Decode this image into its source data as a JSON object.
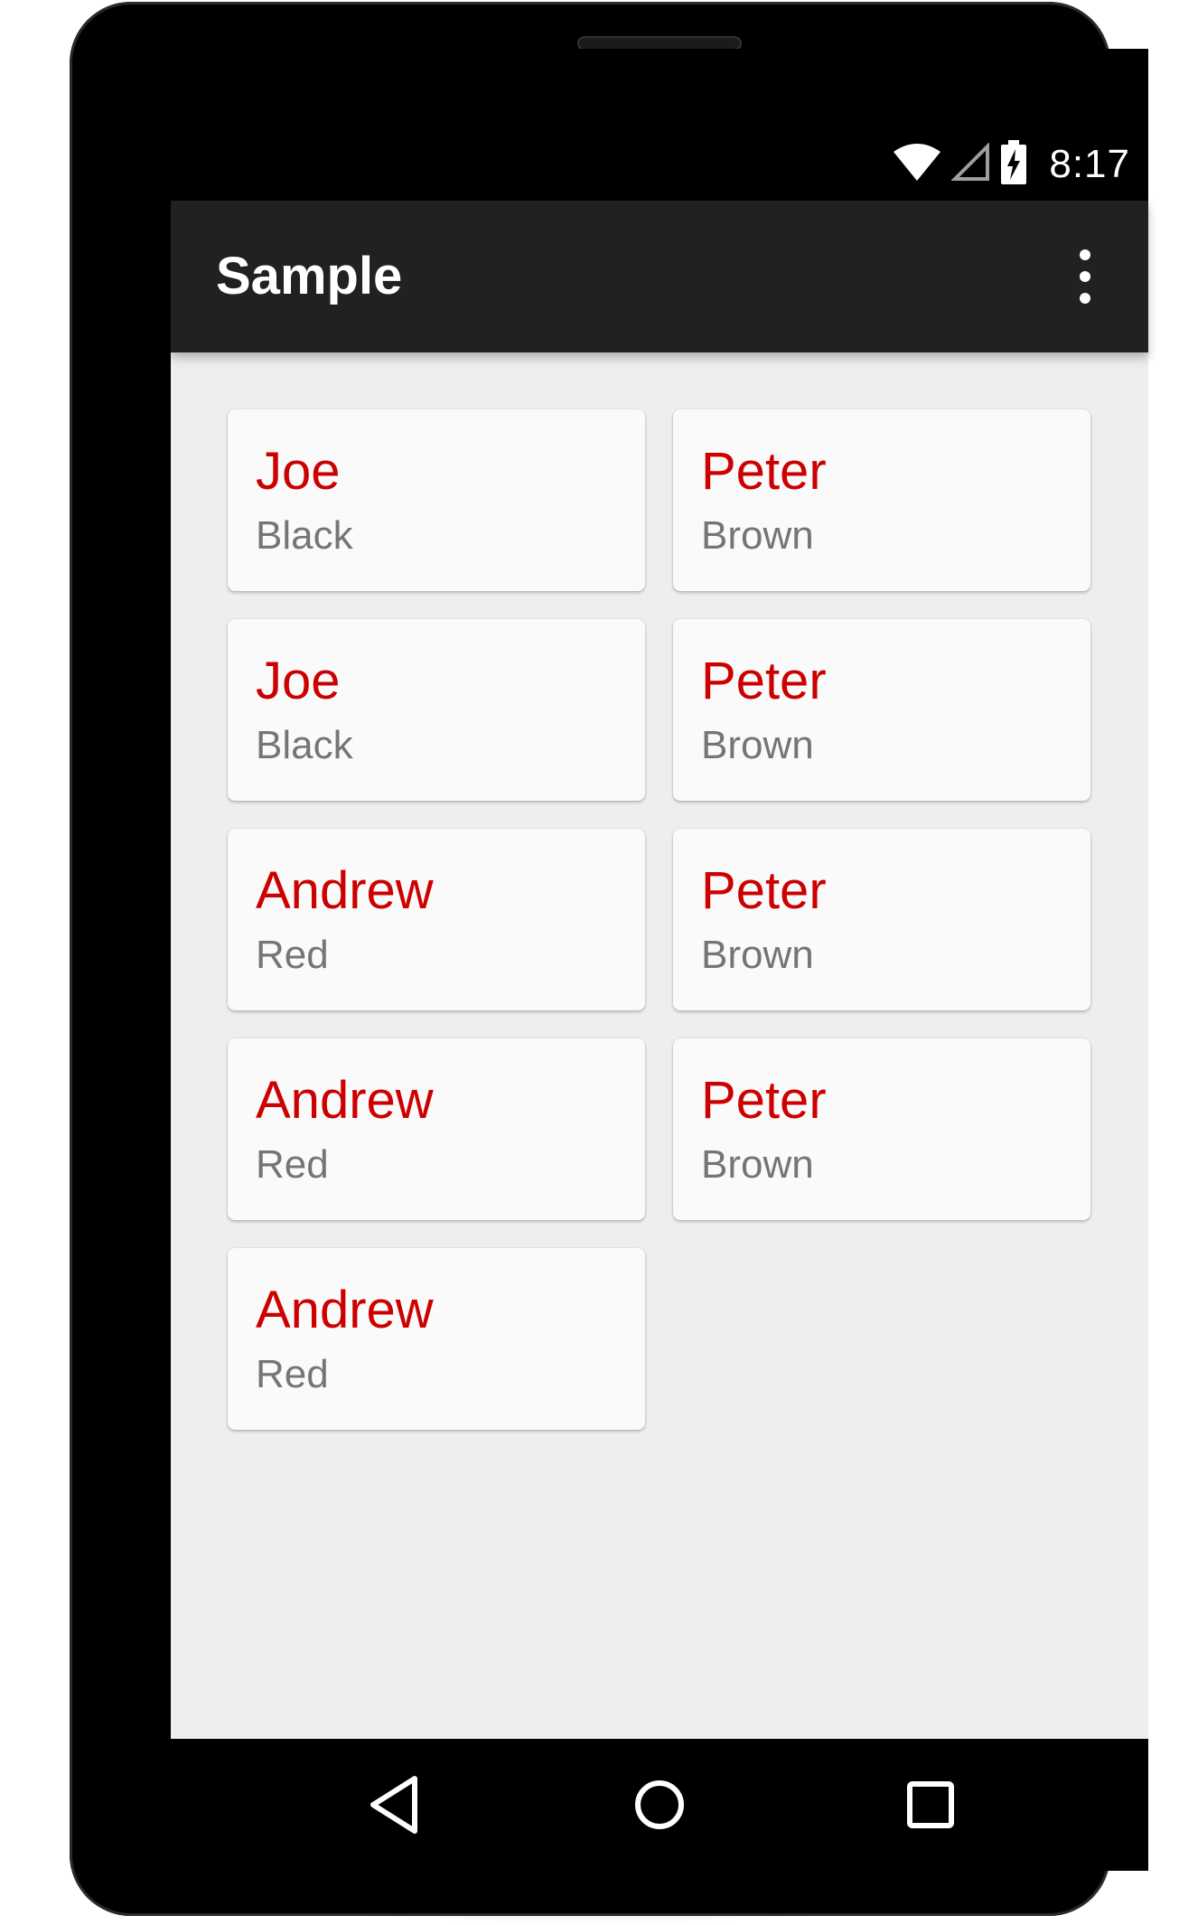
{
  "status_bar": {
    "time": "8:17",
    "icons": [
      "wifi-icon",
      "cell-signal-icon",
      "battery-charging-icon"
    ]
  },
  "app_bar": {
    "title": "Sample",
    "menu_icon": "overflow-menu-icon"
  },
  "cards": [
    {
      "first": "Joe",
      "last": "Black"
    },
    {
      "first": "Peter",
      "last": "Brown"
    },
    {
      "first": "Joe",
      "last": "Black"
    },
    {
      "first": "Peter",
      "last": "Brown"
    },
    {
      "first": "Andrew",
      "last": "Red"
    },
    {
      "first": "Peter",
      "last": "Brown"
    },
    {
      "first": "Andrew",
      "last": "Red"
    },
    {
      "first": "Peter",
      "last": "Brown"
    },
    {
      "first": "Andrew",
      "last": "Red"
    }
  ],
  "nav_bar": {
    "icons": [
      "back-icon",
      "home-icon",
      "recents-icon"
    ]
  },
  "colors": {
    "name_primary": "#cc0000",
    "name_secondary": "#757575",
    "app_bar": "#212121",
    "background": "#eeeeee",
    "card": "#fafafa"
  }
}
